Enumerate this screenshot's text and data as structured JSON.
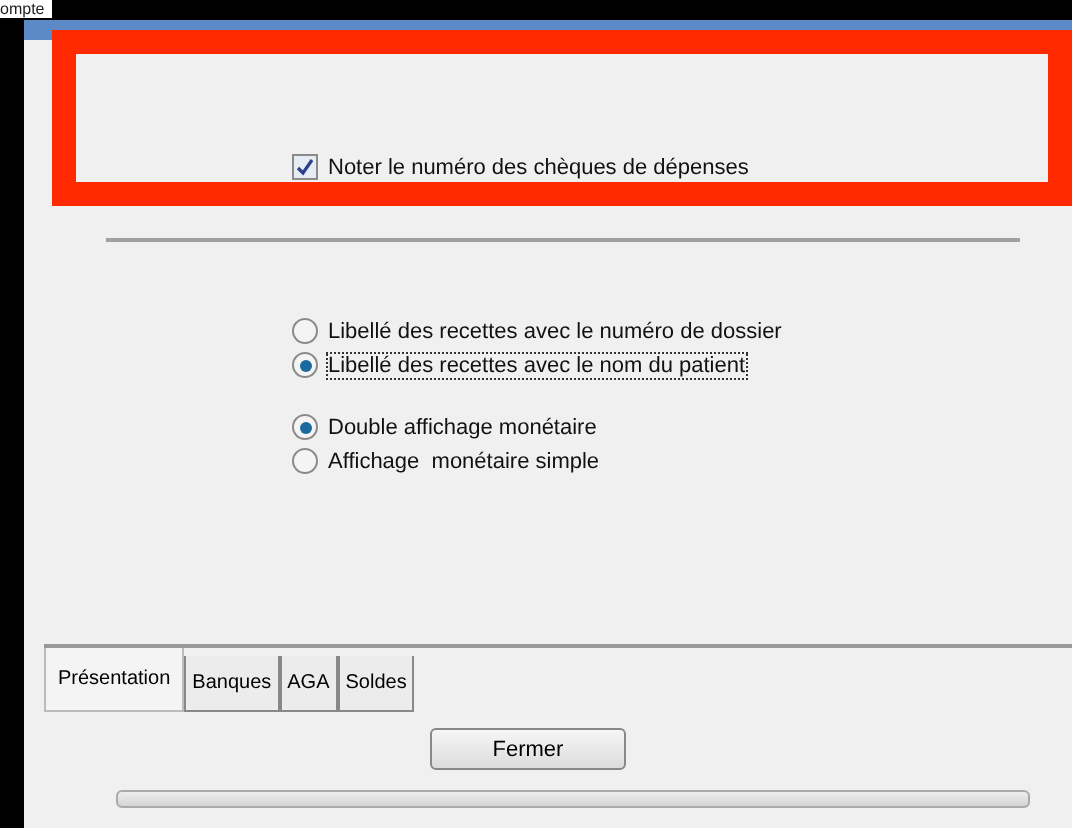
{
  "background_text": "ompte",
  "checkbox": {
    "label": "Noter le numéro des chèques de dépenses",
    "checked": true
  },
  "radio_groups": [
    {
      "options": [
        {
          "label": "Libellé des recettes avec le numéro de dossier",
          "selected": false
        },
        {
          "label": "Libellé des recettes avec le nom du patient",
          "selected": true
        }
      ]
    },
    {
      "options": [
        {
          "label": "Double affichage monétaire",
          "selected": true
        },
        {
          "label": "Affichage  monétaire simple",
          "selected": false
        }
      ]
    }
  ],
  "tabs": [
    {
      "label": "Présentation",
      "selected": true
    },
    {
      "label": "Banques",
      "selected": false
    },
    {
      "label": "AGA",
      "selected": false
    },
    {
      "label": "Soldes",
      "selected": false
    }
  ],
  "buttons": [
    "Fermer"
  ]
}
